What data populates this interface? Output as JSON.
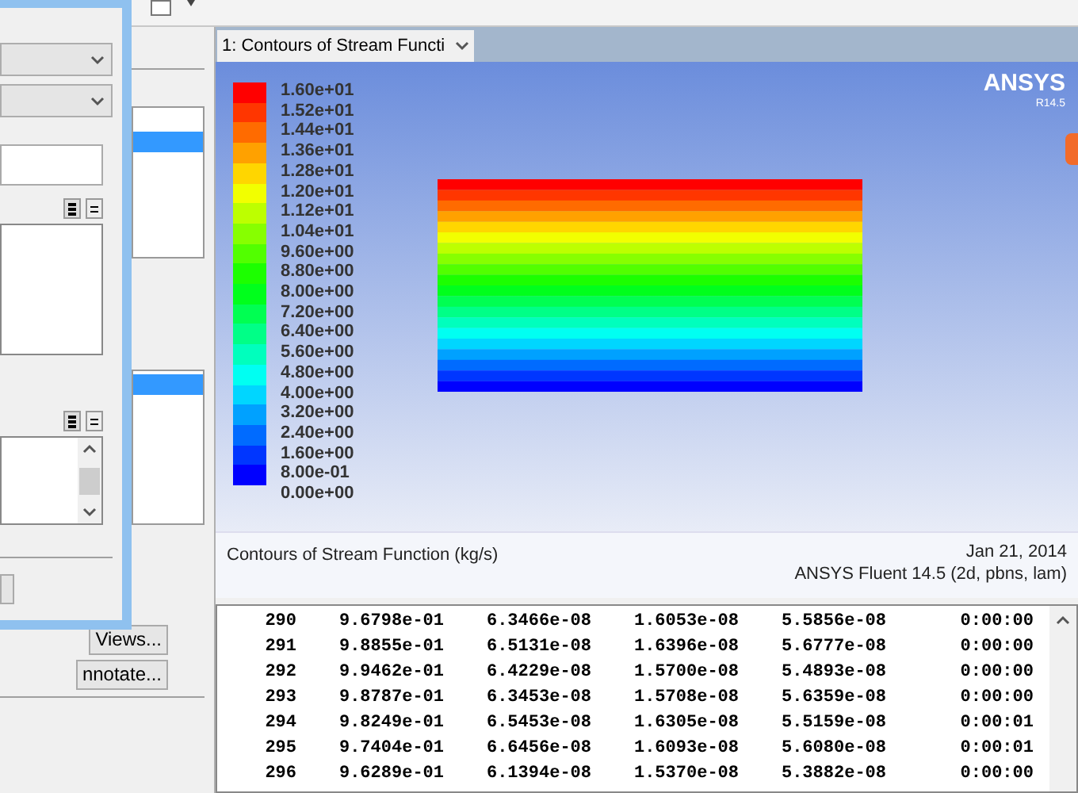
{
  "side_panel": {
    "buttons": [
      "Views...",
      "nnotate..."
    ],
    "lists": [
      {
        "rows": [
          {
            "selected": false
          },
          {
            "selected": true
          },
          {
            "selected": false
          },
          {
            "selected": false
          },
          {
            "selected": false
          },
          {
            "selected": false
          }
        ]
      },
      {
        "rows": [
          {
            "selected": true
          },
          {
            "selected": false
          },
          {
            "selected": false
          },
          {
            "selected": false
          },
          {
            "selected": false
          },
          {
            "selected": false
          },
          {
            "selected": false
          }
        ]
      }
    ]
  },
  "graphics": {
    "selector": "1: Contours of Stream Functi",
    "logo": "ANSYS",
    "release": "R14.5",
    "legend": {
      "labels": [
        "1.60e+01",
        "1.52e+01",
        "1.44e+01",
        "1.36e+01",
        "1.28e+01",
        "1.20e+01",
        "1.12e+01",
        "1.04e+01",
        "9.60e+00",
        "8.80e+00",
        "8.00e+00",
        "7.20e+00",
        "6.40e+00",
        "5.60e+00",
        "4.80e+00",
        "4.00e+00",
        "3.20e+00",
        "2.40e+00",
        "1.60e+00",
        "8.00e-01",
        "0.00e+00"
      ],
      "bands": [
        {
          "color": "#ff0000"
        },
        {
          "color": "#ff3600"
        },
        {
          "color": "#ff6b00"
        },
        {
          "color": "#ffa100"
        },
        {
          "color": "#ffd600"
        },
        {
          "color": "#f2ff00"
        },
        {
          "color": "#bdff00"
        },
        {
          "color": "#87ff00"
        },
        {
          "color": "#52ff00"
        },
        {
          "color": "#1cff00"
        },
        {
          "color": "#00ff1c"
        },
        {
          "color": "#00ff52"
        },
        {
          "color": "#00ff87"
        },
        {
          "color": "#00ffbd"
        },
        {
          "color": "#00fff2"
        },
        {
          "color": "#00d6ff"
        },
        {
          "color": "#00a1ff"
        },
        {
          "color": "#006bff"
        },
        {
          "color": "#0036ff"
        },
        {
          "color": "#0000ff"
        }
      ]
    },
    "caption": "Contours of Stream Function (kg/s)",
    "date": "Jan 21, 2014",
    "version": "ANSYS Fluent 14.5 (2d, pbns, lam)"
  },
  "console": {
    "rows": [
      [
        "290",
        "9.6798e-01",
        "6.3466e-08",
        "1.6053e-08",
        "5.5856e-08",
        "0:00:00"
      ],
      [
        "291",
        "9.8855e-01",
        "6.5131e-08",
        "1.6396e-08",
        "5.6777e-08",
        "0:00:00"
      ],
      [
        "292",
        "9.9462e-01",
        "6.4229e-08",
        "1.5700e-08",
        "5.4893e-08",
        "0:00:00"
      ],
      [
        "293",
        "9.8787e-01",
        "6.3453e-08",
        "1.5708e-08",
        "5.6359e-08",
        "0:00:00"
      ],
      [
        "294",
        "9.8249e-01",
        "6.5453e-08",
        "1.6305e-08",
        "5.5159e-08",
        "0:00:01"
      ],
      [
        "295",
        "9.7404e-01",
        "6.6456e-08",
        "1.6093e-08",
        "5.6080e-08",
        "0:00:01"
      ],
      [
        "296",
        "9.6289e-01",
        "6.1394e-08",
        "1.5370e-08",
        "5.3882e-08",
        "0:00:00"
      ]
    ]
  }
}
